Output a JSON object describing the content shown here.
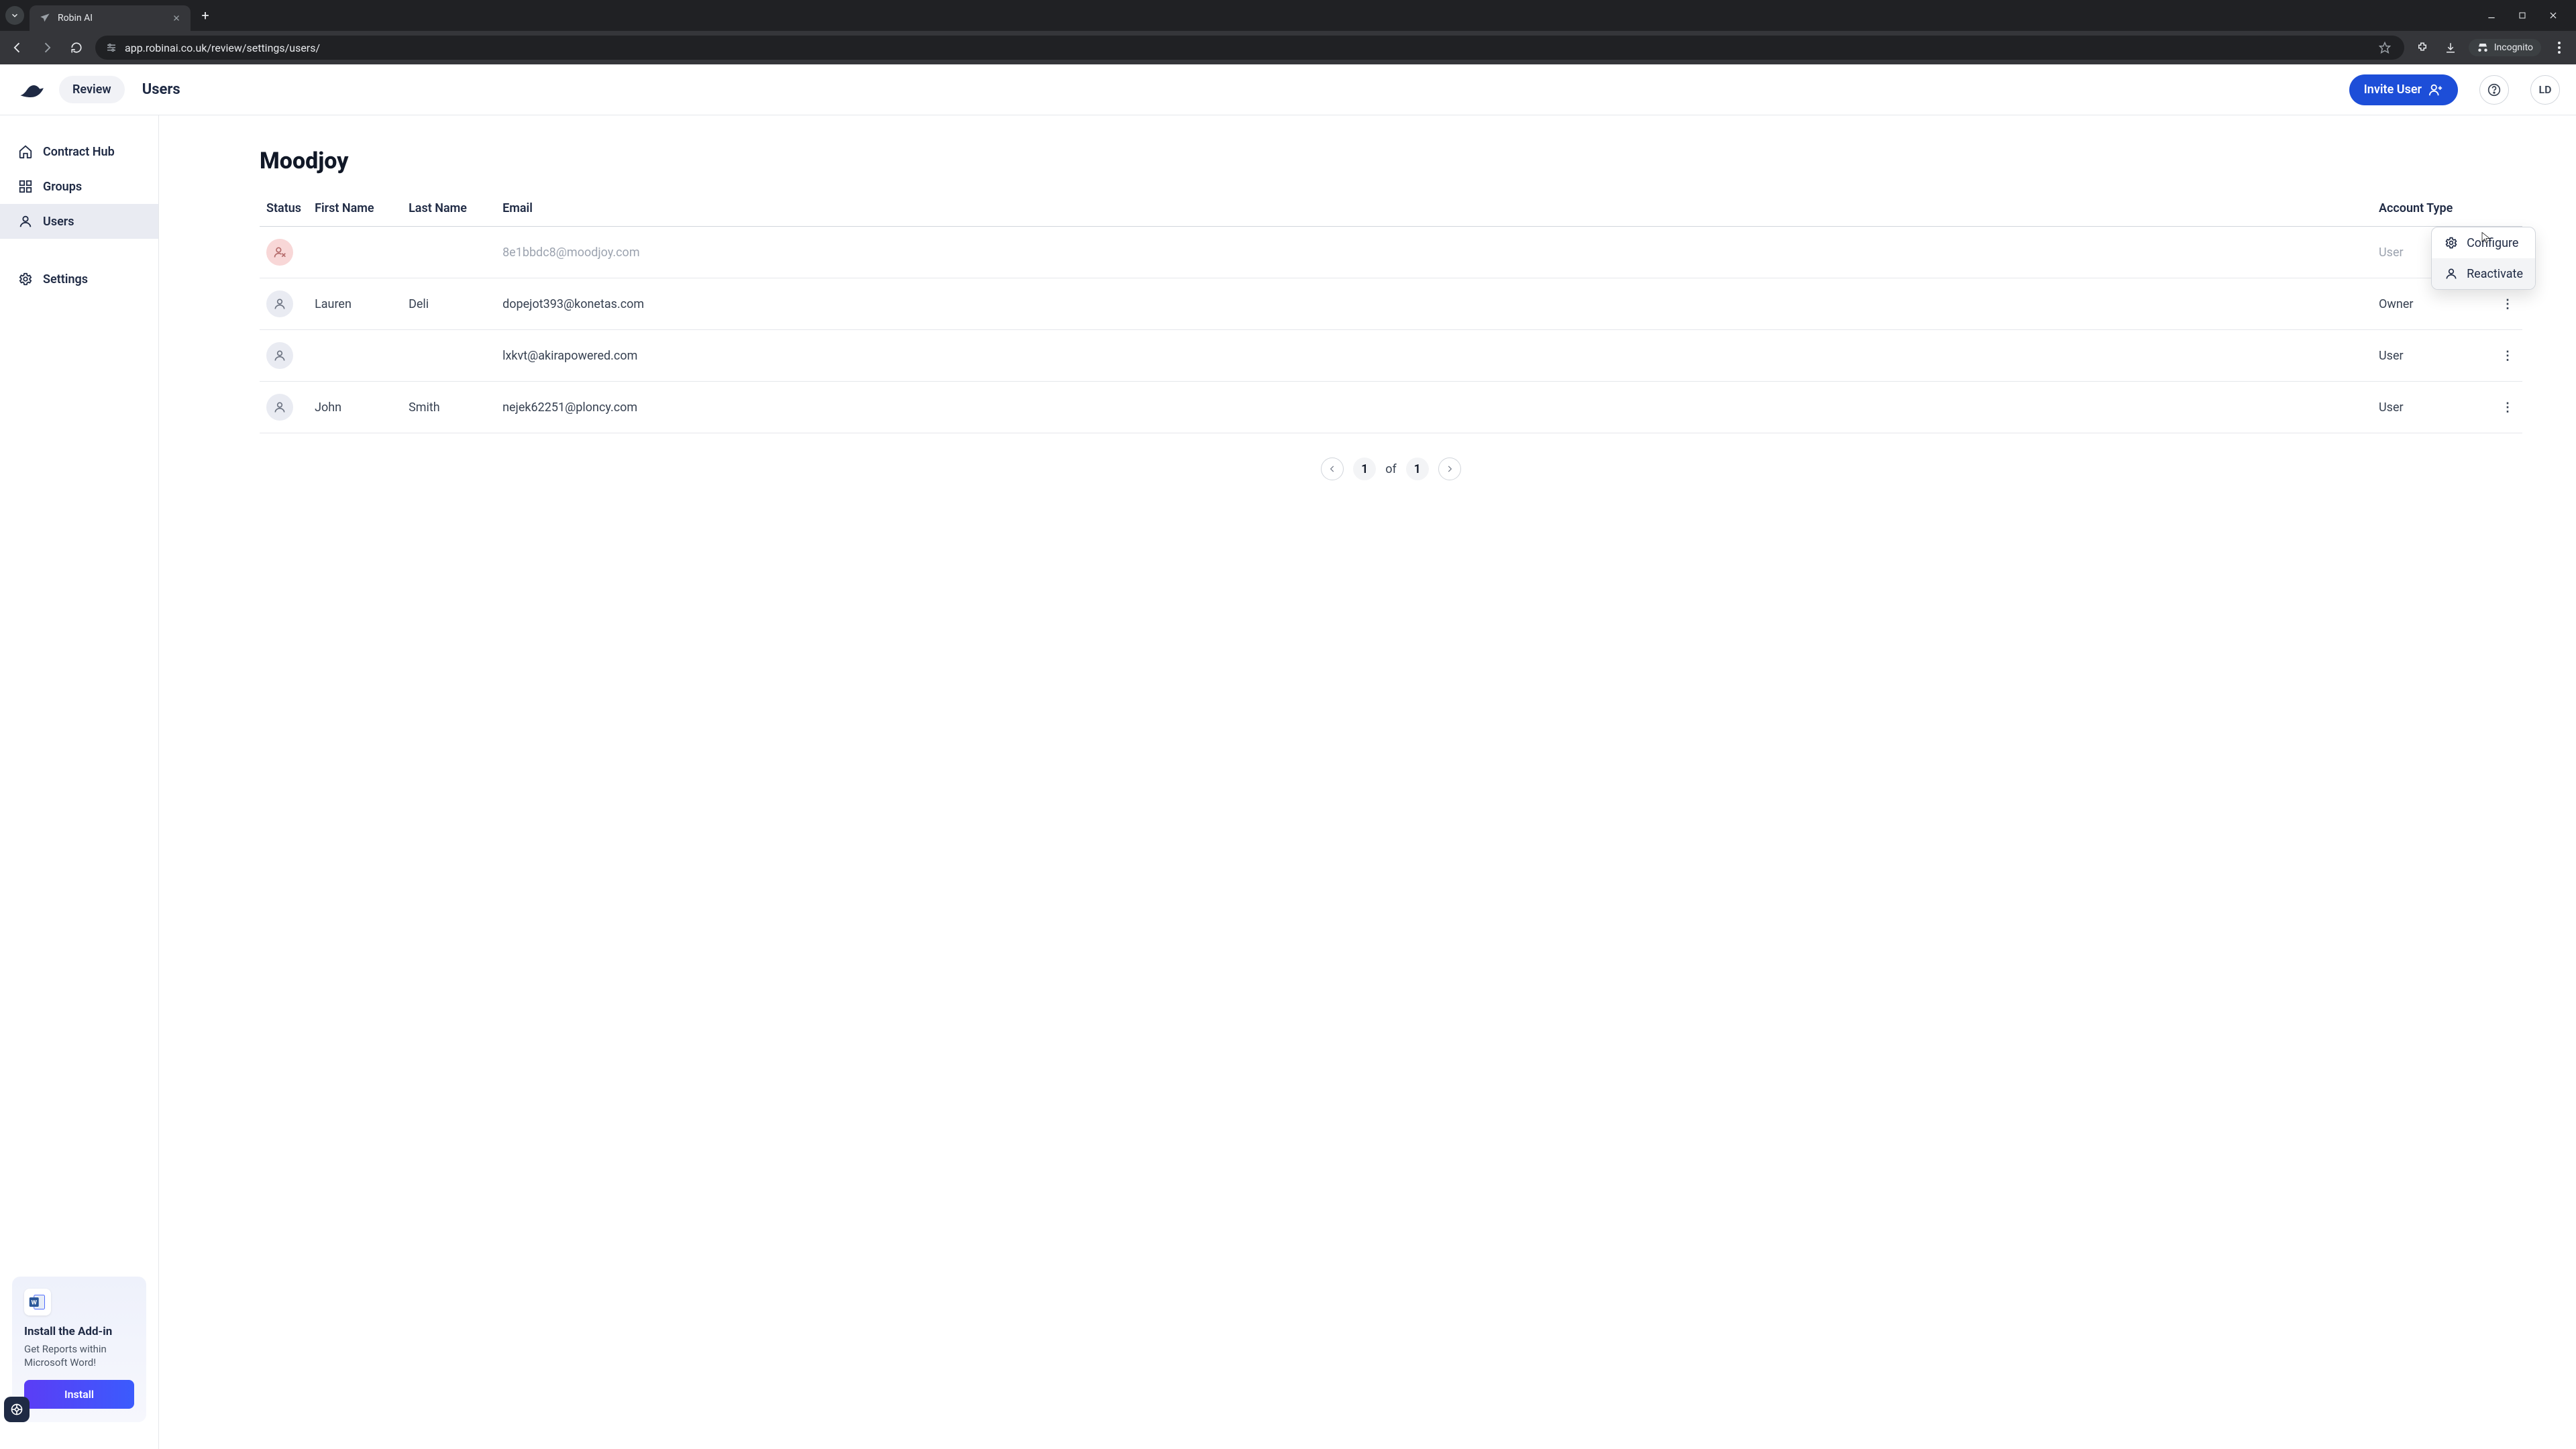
{
  "browser": {
    "tab_title": "Robin AI",
    "url": "app.robinai.co.uk/review/settings/users/",
    "incognito_label": "Incognito"
  },
  "header": {
    "review_pill": "Review",
    "page_name": "Users",
    "invite_label": "Invite User",
    "avatar_initials": "LD"
  },
  "sidebar": {
    "items": [
      {
        "label": "Contract Hub"
      },
      {
        "label": "Groups"
      },
      {
        "label": "Users"
      },
      {
        "label": "Settings"
      }
    ],
    "addin": {
      "title": "Install the Add-in",
      "desc": "Get Reports within Microsoft Word!",
      "button": "Install"
    }
  },
  "content": {
    "org_title": "Moodjoy",
    "columns": [
      "Status",
      "First Name",
      "Last Name",
      "Email",
      "Account Type"
    ],
    "rows": [
      {
        "inactive": true,
        "first": "",
        "last": "",
        "email": "8e1bbdc8@moodjoy.com",
        "type": "User"
      },
      {
        "inactive": false,
        "first": "Lauren",
        "last": "Deli",
        "email": "dopejot393@konetas.com",
        "type": "Owner"
      },
      {
        "inactive": false,
        "first": "",
        "last": "",
        "email": "lxkvt@akirapowered.com",
        "type": "User"
      },
      {
        "inactive": false,
        "first": "John",
        "last": "Smith",
        "email": "nejek62251@ploncy.com",
        "type": "User"
      }
    ],
    "popover": {
      "configure": "Configure",
      "reactivate": "Reactivate"
    },
    "pager": {
      "current": "1",
      "of": "of",
      "total": "1"
    }
  }
}
